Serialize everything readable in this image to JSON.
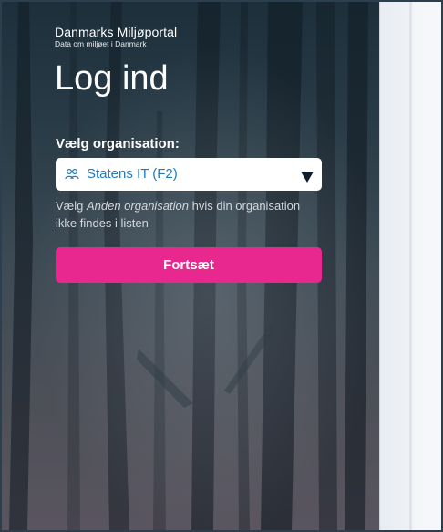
{
  "brand": {
    "name": "Danmarks Miljøportal",
    "tagline": "Data om miljøet i Danmark"
  },
  "page": {
    "title": "Log ind"
  },
  "organisation": {
    "label": "Vælg organisation:",
    "selected": "Statens IT (F2)",
    "icon": "users-icon",
    "hint_before": "Vælg ",
    "hint_emphasis": "Anden organisation",
    "hint_after": " hvis din organisation ikke findes i listen"
  },
  "actions": {
    "continue_label": "Fortsæt"
  },
  "colors": {
    "accent_pink": "#e8288f",
    "link_blue": "#1e7bbf",
    "panel_dark": "#1d2f3a"
  }
}
